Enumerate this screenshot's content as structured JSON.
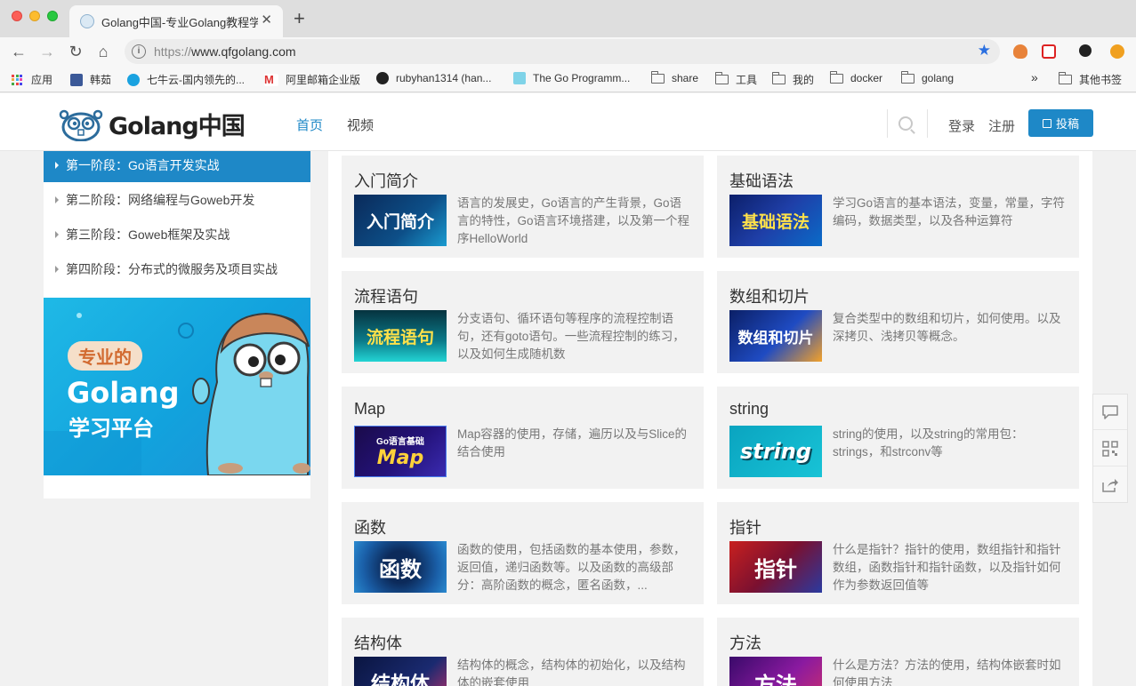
{
  "browser": {
    "tab_title": "Golang中国-专业Golang教程学",
    "url_scheme": "https://",
    "url_host": "www.qfgolang.com",
    "bookmarks": [
      {
        "label": "应用"
      },
      {
        "label": "韩茹"
      },
      {
        "label": "七牛云-国内领先的..."
      },
      {
        "label": "阿里邮箱企业版"
      },
      {
        "label": "rubyhan1314 (han..."
      },
      {
        "label": "The Go Programm..."
      },
      {
        "label": "share"
      },
      {
        "label": "工具"
      },
      {
        "label": "我的"
      },
      {
        "label": "docker"
      },
      {
        "label": "golang"
      }
    ],
    "more_bookmarks": "»",
    "other_bookmarks": "其他书签"
  },
  "header": {
    "logo_text": "Golang中国",
    "nav": [
      {
        "label": "首页"
      },
      {
        "label": "视频"
      }
    ],
    "login": "登录",
    "register": "注册",
    "post": "投稿"
  },
  "sidebar": {
    "items": [
      {
        "label": "第一阶段：Go语言开发实战"
      },
      {
        "label": "第二阶段：网络编程与Goweb开发"
      },
      {
        "label": "第三阶段：Goweb框架及实战"
      },
      {
        "label": "第四阶段：分布式的微服务及项目实战"
      }
    ],
    "banner": {
      "tag": "专业的",
      "title": "Golang",
      "subtitle": "学习平台"
    }
  },
  "cards": [
    {
      "title": "入门简介",
      "thumb": "入门简介",
      "desc": "语言的发展史，Go语言的产生背景，Go语言的特性，Go语言环境搭建，以及第一个程序HelloWorld"
    },
    {
      "title": "基础语法",
      "thumb": "基础语法",
      "desc": "学习Go语言的基本语法，变量，常量，字符编码，数据类型，以及各种运算符"
    },
    {
      "title": "流程语句",
      "thumb": "流程语句",
      "desc": "分支语句、循环语句等程序的流程控制语句，还有goto语句。一些流程控制的练习，以及如何生成随机数"
    },
    {
      "title": "数组和切片",
      "thumb": "数组和切片",
      "desc": "复合类型中的数组和切片，如何使用。以及深拷贝、浅拷贝等概念。"
    },
    {
      "title": "Map",
      "thumb": "Map",
      "thumb_small": "Go语言基础",
      "desc": "Map容器的使用，存储，遍历以及与Slice的结合使用"
    },
    {
      "title": "string",
      "thumb": "string",
      "desc": "string的使用，以及string的常用包：strings，和strconv等"
    },
    {
      "title": "函数",
      "thumb": "函数",
      "desc": "函数的使用，包括函数的基本使用，参数，返回值，递归函数等。以及函数的高级部分：高阶函数的概念，匿名函数，..."
    },
    {
      "title": "指针",
      "thumb": "指针",
      "desc": "什么是指针？指针的使用，数组指针和指针数组，函数指针和指针函数，以及指针如何作为参数返回值等"
    },
    {
      "title": "结构体",
      "thumb": "结构体",
      "desc": "结构体的概念，结构体的初始化，以及结构体的嵌套使用"
    },
    {
      "title": "方法",
      "thumb": "方法",
      "desc": "什么是方法？方法的使用，结构体嵌套时如何使用方法"
    }
  ],
  "colors": {
    "accent": "#1e88c7",
    "card_bg": "#f2f2f2"
  }
}
